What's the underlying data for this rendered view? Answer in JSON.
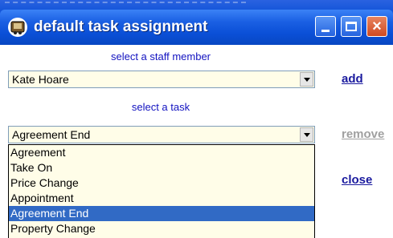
{
  "window": {
    "title": "default task assignment",
    "controls": {
      "minimize": "minimize",
      "maximize": "maximize",
      "close": "×"
    }
  },
  "staff": {
    "prompt": "select a staff member",
    "selected": "Kate Hoare",
    "add_label": "add"
  },
  "task": {
    "prompt": "select a task",
    "selected": "Agreement End",
    "remove_label": "remove",
    "options": [
      "Agreement",
      "Take On",
      "Price Change",
      "Appointment",
      "Agreement End",
      "Property Change"
    ],
    "highlighted": "Agreement End"
  },
  "footer": {
    "close_label": "close"
  },
  "colors": {
    "titlebar": "#0a4fd6",
    "prompt_text": "#1212c0",
    "link": "#1a1a9e",
    "disabled_link": "#a0a0a0",
    "combo_bg": "#fffde8",
    "selection": "#316ac5"
  }
}
